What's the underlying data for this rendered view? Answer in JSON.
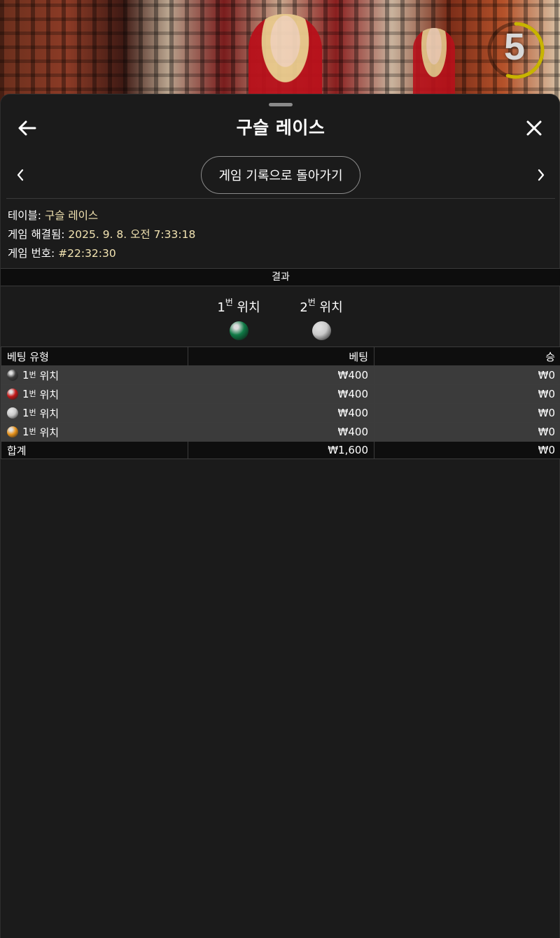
{
  "stream": {
    "countdown": "5",
    "countdown_progress": 0.55
  },
  "sheet": {
    "title": "구슬 레이스",
    "back_history_label": "게임 기록으로 돌아가기"
  },
  "info": {
    "table_label": "테이블:",
    "table_value": "구슬 레이스",
    "resolved_label": "게임 해결됨:",
    "resolved_value": "2025. 9. 8. 오전 7:33:18",
    "game_no_label": "게임 번호:",
    "game_no_value": "#22:32:30"
  },
  "results": {
    "header": "결과",
    "positions": [
      {
        "num": "1",
        "sup": "번",
        "word": "위치",
        "ball_color": "green"
      },
      {
        "num": "2",
        "sup": "번",
        "word": "위치",
        "ball_color": "silver"
      }
    ]
  },
  "bets_table": {
    "headers": {
      "type": "베팅 유형",
      "bet": "베팅",
      "win": "승"
    },
    "rows": [
      {
        "ball_color": "black",
        "num": "1",
        "sup": "번",
        "word": "위치",
        "bet": "₩400",
        "win": "₩0"
      },
      {
        "ball_color": "red",
        "num": "1",
        "sup": "번",
        "word": "위치",
        "bet": "₩400",
        "win": "₩0"
      },
      {
        "ball_color": "silver",
        "num": "1",
        "sup": "번",
        "word": "위치",
        "bet": "₩400",
        "win": "₩0"
      },
      {
        "ball_color": "orange",
        "num": "1",
        "sup": "번",
        "word": "위치",
        "bet": "₩400",
        "win": "₩0"
      }
    ],
    "total": {
      "label": "합계",
      "bet": "₩1,600",
      "win": "₩0"
    }
  },
  "colors": {
    "background": "#1b1b1b",
    "info_value": "#f3e4b2",
    "row_bg": "#3b3b3b",
    "header_bg": "#0e0e0e",
    "ring": "#c8b400",
    "green": "#0f7a46",
    "silver": "#c9c9c9",
    "black": "#3a3a3a",
    "red": "#c21818",
    "orange": "#e7921a"
  },
  "icons": {
    "back": "arrow-left-icon",
    "close": "close-icon",
    "prev": "chevron-left-icon",
    "next": "chevron-right-icon"
  }
}
